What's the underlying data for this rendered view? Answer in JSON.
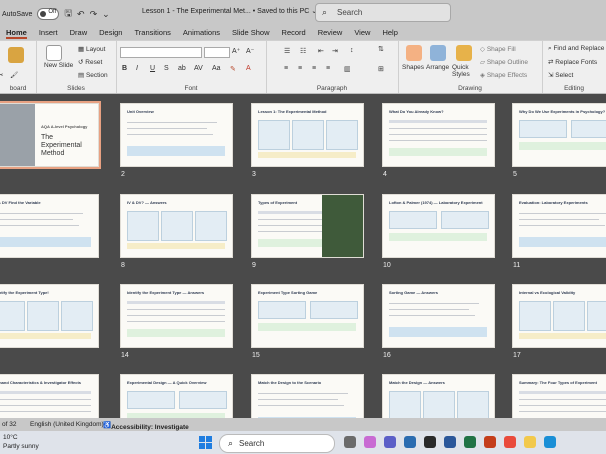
{
  "titlebar": {
    "autosave_label": "AutoSave",
    "autosave_state": "Off",
    "doc_title": "Lesson 1 - The Experimental Met...  •  Saved to this PC ⌄",
    "search_placeholder": "Search"
  },
  "menu": [
    "Home",
    "Insert",
    "Draw",
    "Design",
    "Transitions",
    "Animations",
    "Slide Show",
    "Record",
    "Review",
    "View",
    "Help"
  ],
  "ribbon": {
    "clipboard_label": "board",
    "slides": {
      "new_slide": "New Slide",
      "layout": "Layout",
      "reset": "Reset",
      "section": "Section",
      "label": "Slides"
    },
    "font_label": "Font",
    "paragraph_label": "Paragraph",
    "drawing": {
      "shapes": "Shapes",
      "arrange": "Arrange",
      "quick_styles": "Quick Styles",
      "shape_fill": "Shape Fill",
      "shape_outline": "Shape Outline",
      "shape_effects": "Shape Effects",
      "label": "Drawing"
    },
    "editing": {
      "find": "Find and Replace",
      "replace_fonts": "Replace Fonts",
      "select": "Select",
      "label": "Editing"
    }
  },
  "slides": [
    {
      "num": "",
      "title": "AQA A-level Psychology",
      "subtitle": "The Experimental Method",
      "selected": true
    },
    {
      "num": "2",
      "title": "Unit Overview"
    },
    {
      "num": "3",
      "title": "Lesson 1: The Experimental Method"
    },
    {
      "num": "4",
      "title": "What Do You Already Know?"
    },
    {
      "num": "5",
      "title": "Why Do We Use Experiments in Psychology?"
    },
    {
      "num": "",
      "title": "IV & DV Find the Variable"
    },
    {
      "num": "8",
      "title": "IV & DV? — Answers"
    },
    {
      "num": "9",
      "title": "Types of Experiment"
    },
    {
      "num": "10",
      "title": "Lofton & Palmer (1974) — Laboratory Experiment"
    },
    {
      "num": "11",
      "title": "Evaluation: Laboratory Experiments"
    },
    {
      "num": "",
      "title": "Identify the Experiment Type!"
    },
    {
      "num": "14",
      "title": "Identify the Experiment Type — Answers"
    },
    {
      "num": "15",
      "title": "Experiment Type Sorting Game"
    },
    {
      "num": "16",
      "title": "Sorting Game — Answers"
    },
    {
      "num": "17",
      "title": "Internal vs Ecological Validity"
    },
    {
      "num": "",
      "title": "Demand Characteristics & Investigator Effects"
    },
    {
      "num": "",
      "title": "Experimental Design — A Quick Overview"
    },
    {
      "num": "",
      "title": "Match the Design to the Scenario"
    },
    {
      "num": "",
      "title": "Match the Design — Answers"
    },
    {
      "num": "",
      "title": "Summary: The Four Types of Experiment"
    }
  ],
  "status": {
    "slide_count": "of 32",
    "language": "English (United Kingdom)",
    "accessibility": "Accessibility: Investigate"
  },
  "taskbar": {
    "temp": "10°C",
    "weather": "Partly sunny",
    "search": "Search"
  }
}
